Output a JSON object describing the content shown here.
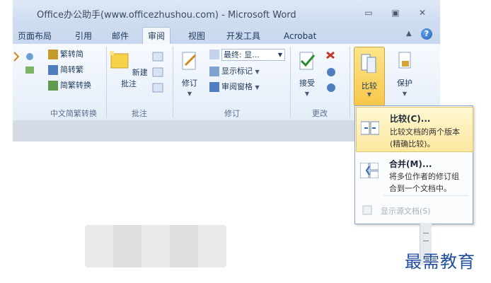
{
  "window": {
    "title": "Office办公助手(www.officezhushou.com) - Microsoft Word",
    "minimize": "▭",
    "restore": "▣",
    "close": "✕"
  },
  "tabs": [
    "页面布局",
    "引用",
    "邮件",
    "审阅",
    "视图",
    "开发工具",
    "Acrobat"
  ],
  "active_tab": "审阅",
  "help": "?",
  "ribbon": {
    "chinese_convert": {
      "items": [
        "繁转简",
        "简转繁",
        "简繁转换"
      ],
      "label": "中文简繁转换"
    },
    "comments": {
      "new_comment": "新建批注",
      "label": "批注"
    },
    "tracking": {
      "track_changes": "修订",
      "final_display": "最终: 显...",
      "show_markup": "显示标记",
      "reviewing_pane": "审阅窗格",
      "label": "修订"
    },
    "changes": {
      "accept": "接受",
      "label": "更改"
    },
    "compare": {
      "label": "比较"
    },
    "protect": {
      "label": "保护"
    }
  },
  "compare_menu": {
    "compare": {
      "title": "比较(C)...",
      "desc": [
        "比较文档的两个版本",
        "(精确比较)。"
      ]
    },
    "combine": {
      "title": "合并(M)...",
      "desc": [
        "将多位作者的修订组",
        "合到一个文档中。"
      ]
    },
    "show_source": "显示源文档(S)"
  },
  "watermark": "最需教育",
  "colors": {
    "accent": "#1e4e9c",
    "highlight": "#fde8a0",
    "ribbon_bg": "#e4edf8"
  }
}
